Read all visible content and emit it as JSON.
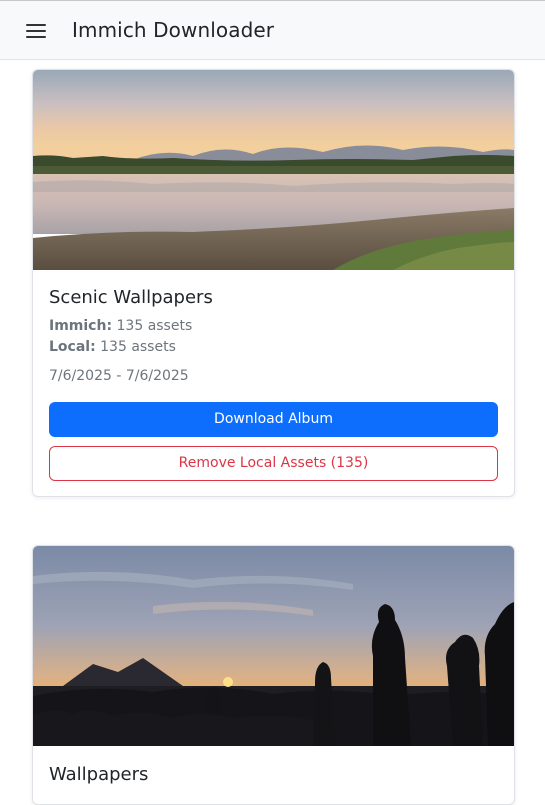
{
  "navbar": {
    "title": "Immich Downloader",
    "menu_icon": "hamburger-menu-icon"
  },
  "albums": [
    {
      "title": "Scenic Wallpapers",
      "immich_label": "Immich:",
      "immich_value": "135 assets",
      "local_label": "Local:",
      "local_value": "135 assets",
      "date_range": "7/6/2025 - 7/6/2025",
      "download_label": "Download Album",
      "remove_label": "Remove Local Assets (135)"
    },
    {
      "title": "Wallpapers"
    }
  ],
  "colors": {
    "primary": "#0d6efd",
    "danger": "#dc3545",
    "navbar_bg": "#f8f9fa"
  }
}
